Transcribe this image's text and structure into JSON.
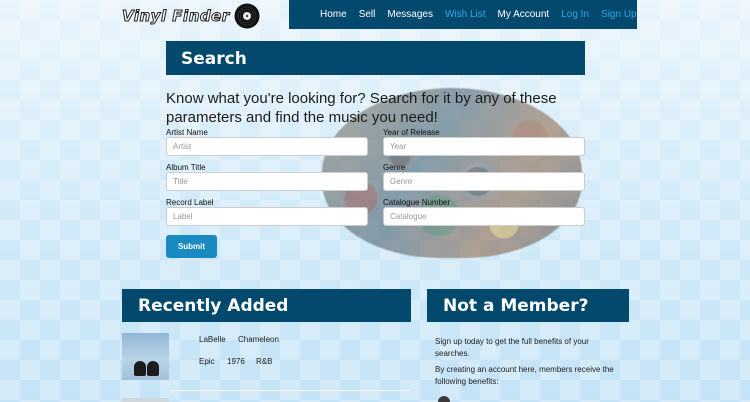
{
  "brand": {
    "logo_text": "Vinyl Finder"
  },
  "nav": {
    "items": [
      {
        "label": "Home",
        "muted": false
      },
      {
        "label": "Sell",
        "muted": false
      },
      {
        "label": "Messages",
        "muted": false
      },
      {
        "label": "Wish List",
        "muted": true
      },
      {
        "label": "My Account",
        "muted": false
      },
      {
        "label": "Log In",
        "muted": true
      },
      {
        "label": "Sign Up",
        "muted": true
      }
    ]
  },
  "search": {
    "title": "Search",
    "intro": "Know what you're looking for? Search for it by any of these parameters and find the music you need!",
    "fields": {
      "artist": {
        "label": "Artist Name",
        "placeholder": "Artist"
      },
      "year": {
        "label": "Year of Release",
        "placeholder": "Year"
      },
      "album": {
        "label": "Album Title",
        "placeholder": "Title"
      },
      "genre": {
        "label": "Genre",
        "placeholder": "Genre"
      },
      "record_label": {
        "label": "Record Label",
        "placeholder": "Label"
      },
      "catalogue": {
        "label": "Catalogue Number",
        "placeholder": "Catalogue"
      }
    },
    "submit_label": "Submit"
  },
  "recent": {
    "title": "Recently Added",
    "items": [
      {
        "artist": "LaBelle",
        "title": "Chameleon",
        "label": "Epic",
        "year": "1976",
        "genre": "R&B"
      }
    ]
  },
  "member": {
    "title": "Not a Member?",
    "text1": "Sign up today to get the full benefits of your searches.",
    "text2": "By creating an account here, members receive the following benefits:"
  },
  "colors": {
    "header_bg": "#03496e",
    "accent": "#1a8ac3",
    "muted_link": "#2ea8e6"
  }
}
